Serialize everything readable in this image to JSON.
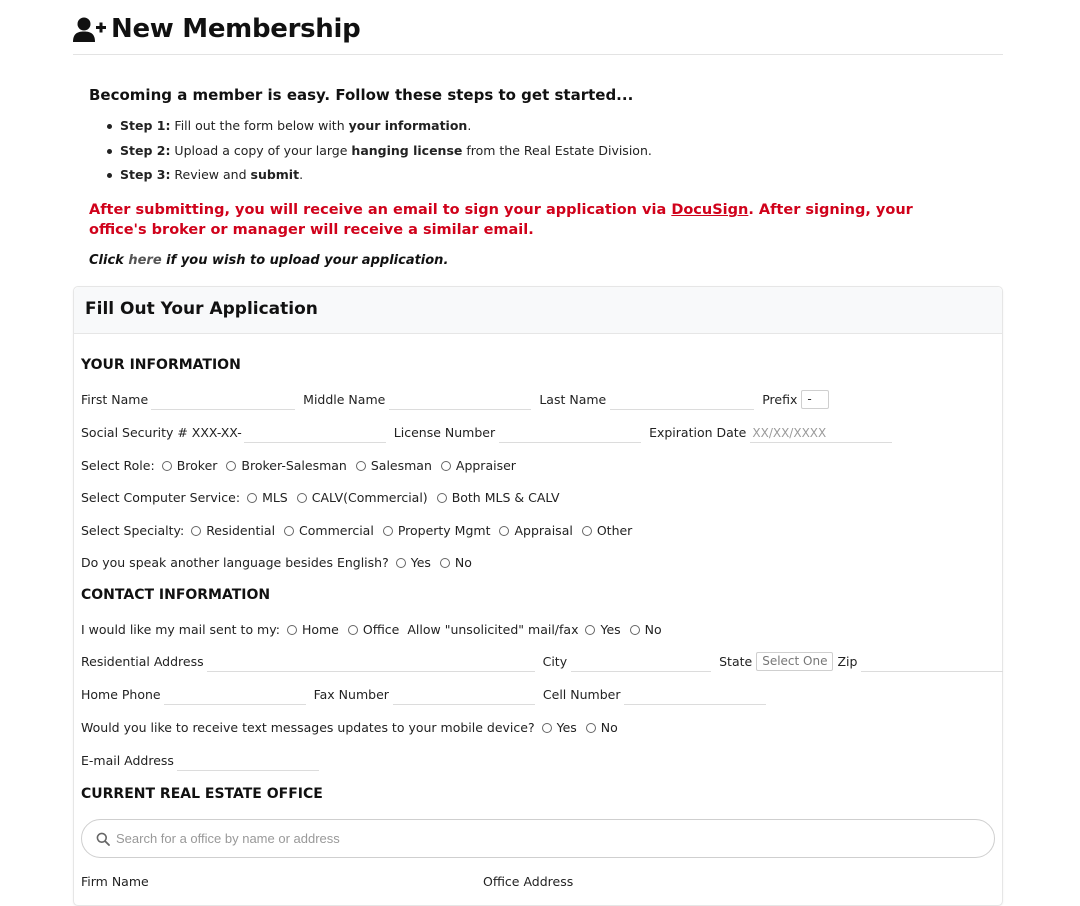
{
  "header": {
    "icon": "user-plus-icon",
    "title": "New Membership"
  },
  "intro": {
    "heading": "Becoming a member is easy. Follow these steps to get started...",
    "steps": [
      {
        "label": "Step 1:",
        "pre": " Fill out the form below with ",
        "strong": "your information",
        "post": "."
      },
      {
        "label": "Step 2:",
        "pre": " Upload a copy of your large ",
        "strong": "hanging license",
        "post": " from the Real Estate Division."
      },
      {
        "label": "Step 3:",
        "pre": " Review and ",
        "strong": "submit",
        "post": "."
      }
    ],
    "notice_pre": "After submitting, you will receive an email to sign your application via ",
    "notice_link": "DocuSign",
    "notice_post": ". After signing, your office's broker or manager will receive a similar email.",
    "upload_pre": "Click ",
    "upload_link": "here",
    "upload_post": " if you wish to upload your application."
  },
  "card": {
    "title": "Fill Out Your Application"
  },
  "your_info": {
    "title": "YOUR INFORMATION",
    "first_name": "First Name",
    "middle_name": "Middle Name",
    "last_name": "Last Name",
    "prefix": "Prefix",
    "prefix_value": "-",
    "ssn": "Social Security # XXX-XX-",
    "license": "License Number",
    "expiration": "Expiration Date",
    "expiration_placeholder": "XX/XX/XXXX",
    "role_label": "Select Role:",
    "roles": [
      "Broker",
      "Broker-Salesman",
      "Salesman",
      "Appraiser"
    ],
    "service_label": "Select Computer Service:",
    "services": [
      "MLS",
      "CALV(Commercial)",
      "Both MLS & CALV"
    ],
    "specialty_label": "Select Specialty:",
    "specialties": [
      "Residential",
      "Commercial",
      "Property Mgmt",
      "Appraisal",
      "Other"
    ],
    "language_label": "Do you speak another language besides English?",
    "language_options": [
      "Yes",
      "No"
    ]
  },
  "contact": {
    "title": "CONTACT INFORMATION",
    "mail_label": "I would like my mail sent to my:",
    "mail_options": [
      "Home",
      "Office"
    ],
    "unsolicited_label": "Allow \"unsolicited\" mail/fax",
    "unsolicited_options": [
      "Yes",
      "No"
    ],
    "address": "Residential Address",
    "city": "City",
    "state": "State",
    "state_value": "Select One",
    "zip": "Zip",
    "home_phone": "Home Phone",
    "fax": "Fax Number",
    "cell": "Cell Number",
    "text_label": "Would you like to receive text messages updates to your mobile device?",
    "text_options": [
      "Yes",
      "No"
    ],
    "email": "E-mail Address"
  },
  "office": {
    "title": "CURRENT REAL ESTATE OFFICE",
    "search_icon": "search-icon",
    "search_placeholder": "Search for a office by name or address",
    "firm_name": "Firm Name",
    "office_address": "Office Address"
  }
}
